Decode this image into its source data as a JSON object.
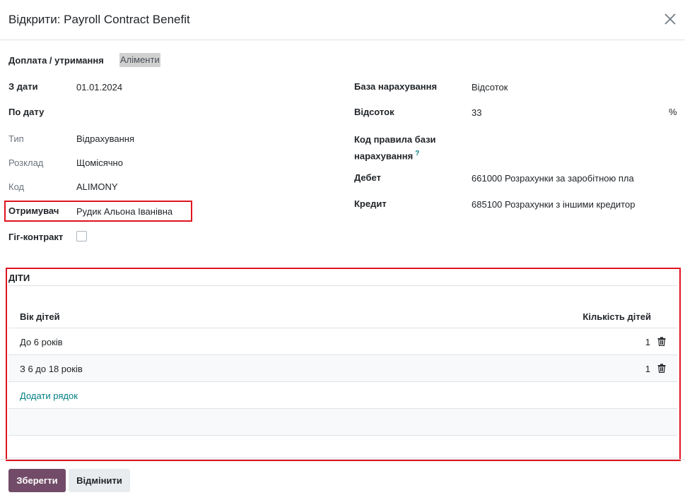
{
  "dialog": {
    "title": "Відкрити: Payroll Contract Benefit"
  },
  "form": {
    "left": {
      "benefit_type_label": "Доплата / утримання",
      "benefit_type_value": "Аліменти",
      "date_from_label": "З дати",
      "date_from_value": "01.01.2024",
      "date_to_label": "По дату",
      "type_label": "Тип",
      "type_value": "Відрахування",
      "schedule_label": "Розклад",
      "schedule_value": "Щомісячно",
      "code_label": "Код",
      "code_value": "ALIMONY",
      "recipient_label": "Отримувач",
      "recipient_value": "Рудик Альона Іванівна",
      "gig_label": "Гіг-контракт",
      "gig_checked": false
    },
    "right": {
      "base_label": "База нарахування",
      "base_value": "Відсоток",
      "percent_label": "Відсоток",
      "percent_value": "33",
      "percent_unit": "%",
      "rule_code_label_line1": "Код правила бази",
      "rule_code_label_line2": "нарахування",
      "help_mark": "?",
      "debit_label": "Дебет",
      "debit_value": "661000 Розрахунки за заробітною пла",
      "credit_label": "Кредит",
      "credit_value": "685100 Розрахунки з іншими кредитор"
    }
  },
  "children": {
    "section_title": "ДІТИ",
    "columns": {
      "age": "Вік дітей",
      "count": "Кількість дітей"
    },
    "rows": [
      {
        "age": "До 6 років",
        "count": "1"
      },
      {
        "age": "З 6 до 18 років",
        "count": "1"
      }
    ],
    "add_line": "Додати рядок"
  },
  "footer": {
    "save": "Зберегти",
    "discard": "Відмінити"
  },
  "colors": {
    "primary": "#714b67",
    "link": "#017e84",
    "highlight": "#e0141e"
  }
}
